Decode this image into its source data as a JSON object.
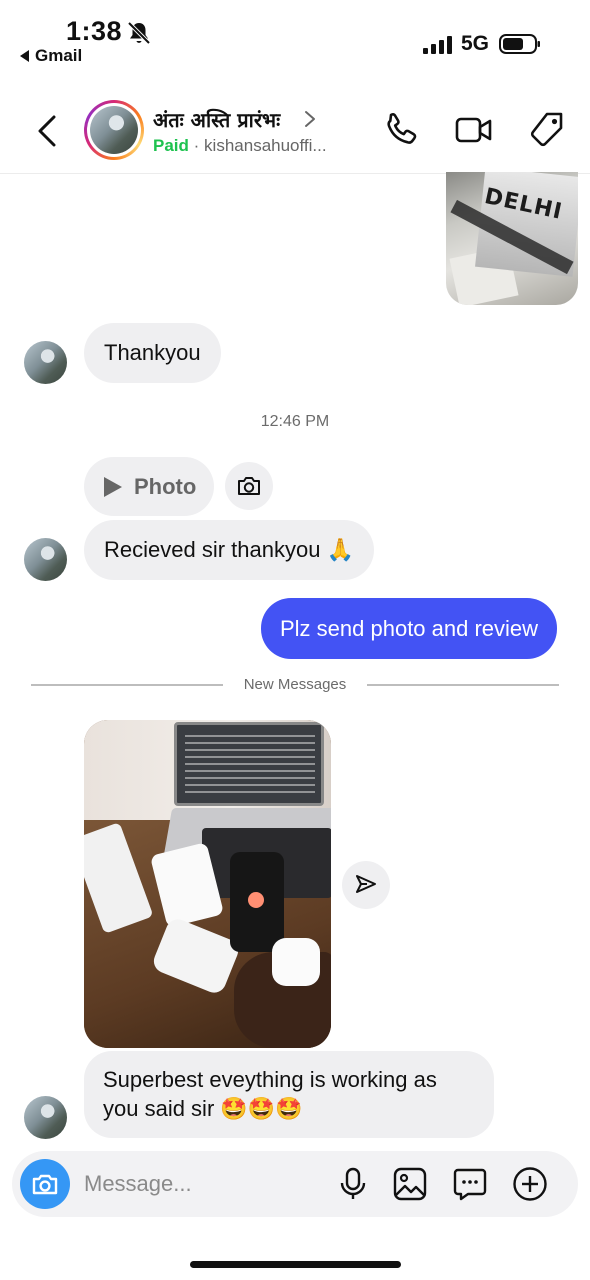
{
  "status_bar": {
    "time": "1:38",
    "back_app": "Gmail",
    "network": "5G"
  },
  "header": {
    "title": "अंतः अस्ति प्रारंभः",
    "paid": "Paid",
    "separator": "·",
    "username": "kishansahuoffi..."
  },
  "messages": {
    "thankyou": "Thankyou",
    "timestamp": "12:46 PM",
    "photo_chip_label": "Photo",
    "received": "Recieved sir thankyou 🙏",
    "outgoing": "Plz send photo and review",
    "new_messages": "New Messages",
    "photo_overlay_text": "DELHI",
    "review": "Superbest eveything is working as you said sir 🤩🤩🤩"
  },
  "composer": {
    "placeholder": "Message..."
  },
  "colors": {
    "outgoing_bubble": "#4353f4",
    "incoming_bubble": "#efeff1",
    "paid_green": "#1ec24f",
    "camera_blue": "#3597f5"
  }
}
